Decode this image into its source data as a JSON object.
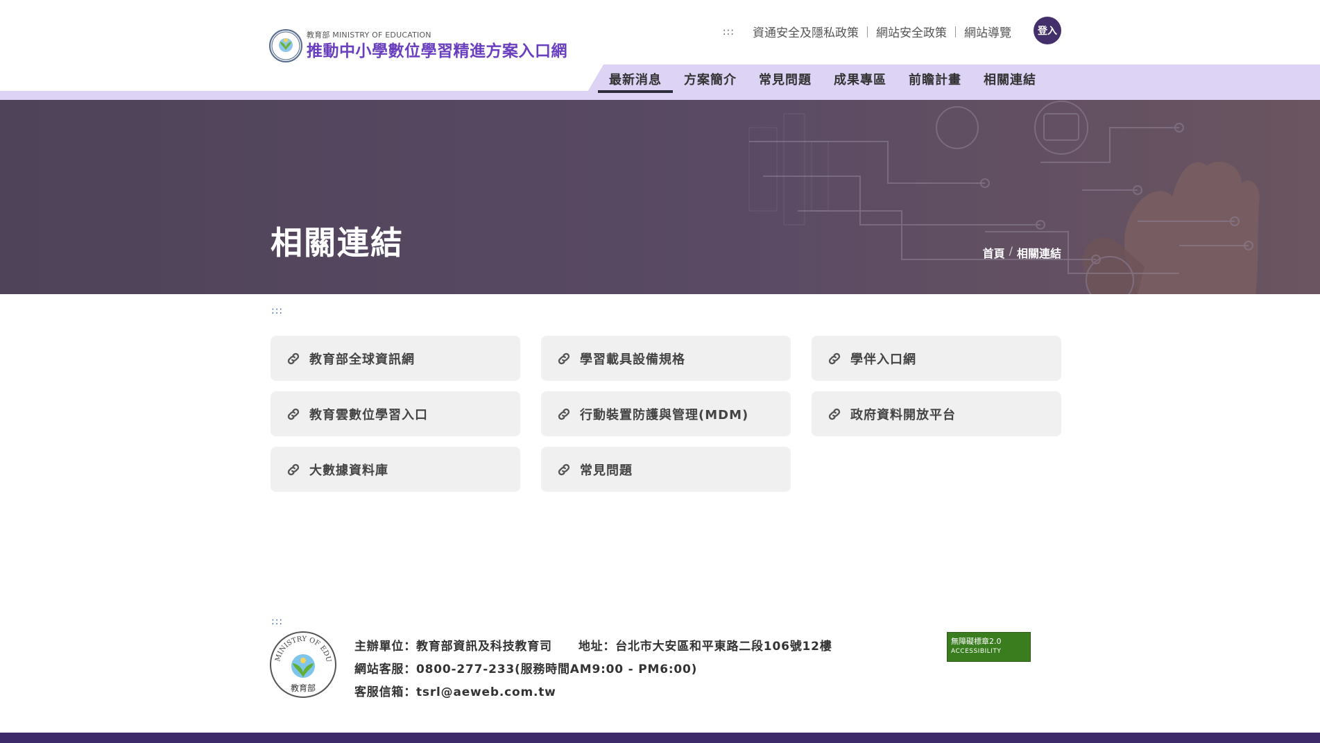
{
  "header": {
    "logo_subtitle": "教育部 MINISTRY OF EDUCATION",
    "logo_title": "推動中小學數位學習精進方案入口網",
    "accesskey": ":::",
    "top_links": [
      "資通安全及隱私政策",
      "網站安全政策",
      "網站導覽"
    ],
    "login_label": "登入",
    "nav": [
      {
        "label": "最新消息",
        "active": true
      },
      {
        "label": "方案簡介"
      },
      {
        "label": "常見問題"
      },
      {
        "label": "成果專區"
      },
      {
        "label": "前瞻計畫"
      },
      {
        "label": "相關連結"
      }
    ],
    "colors": {
      "nav_bg": "#ddd3f5",
      "title": "#6a3fbf",
      "login_bg": "#43306b"
    }
  },
  "banner": {
    "title": "相關連結",
    "breadcrumb": [
      "首頁",
      "相關連結"
    ],
    "breadcrumb_separator": "/",
    "bg_color": "#4e4358"
  },
  "main": {
    "accesskey": ":::",
    "links": [
      {
        "label": "教育部全球資訊網",
        "icon": "link-icon"
      },
      {
        "label": "學習載具設備規格",
        "icon": "link-icon"
      },
      {
        "label": "學伴入口網",
        "icon": "link-icon"
      },
      {
        "label": "教育雲數位學習入口",
        "icon": "link-icon"
      },
      {
        "label": "行動裝置防護與管理(MDM)",
        "icon": "link-icon"
      },
      {
        "label": "政府資料開放平台",
        "icon": "link-icon"
      },
      {
        "label": "大數據資料庫",
        "icon": "link-icon"
      },
      {
        "label": "常見問題",
        "icon": "link-icon"
      }
    ]
  },
  "footer": {
    "accesskey": ":::",
    "organizer": "主辦單位：教育部資訊及科技教育司",
    "address": "地址：台北市大安區和平東路二段106號12樓",
    "service": "網站客服：0800-277-233(服務時間AM9:00 - PM6:00)",
    "email": "客服信箱：tsrl@aeweb.com.tw",
    "a11y_badge_line1": "無障礙標章2.0",
    "a11y_badge_line2": "ACCESSIBILITY",
    "logo_ring_text": "MINISTRY OF EDUCATION",
    "logo_bottom_text": "教育部",
    "bar_color": "#3d2a6b"
  }
}
